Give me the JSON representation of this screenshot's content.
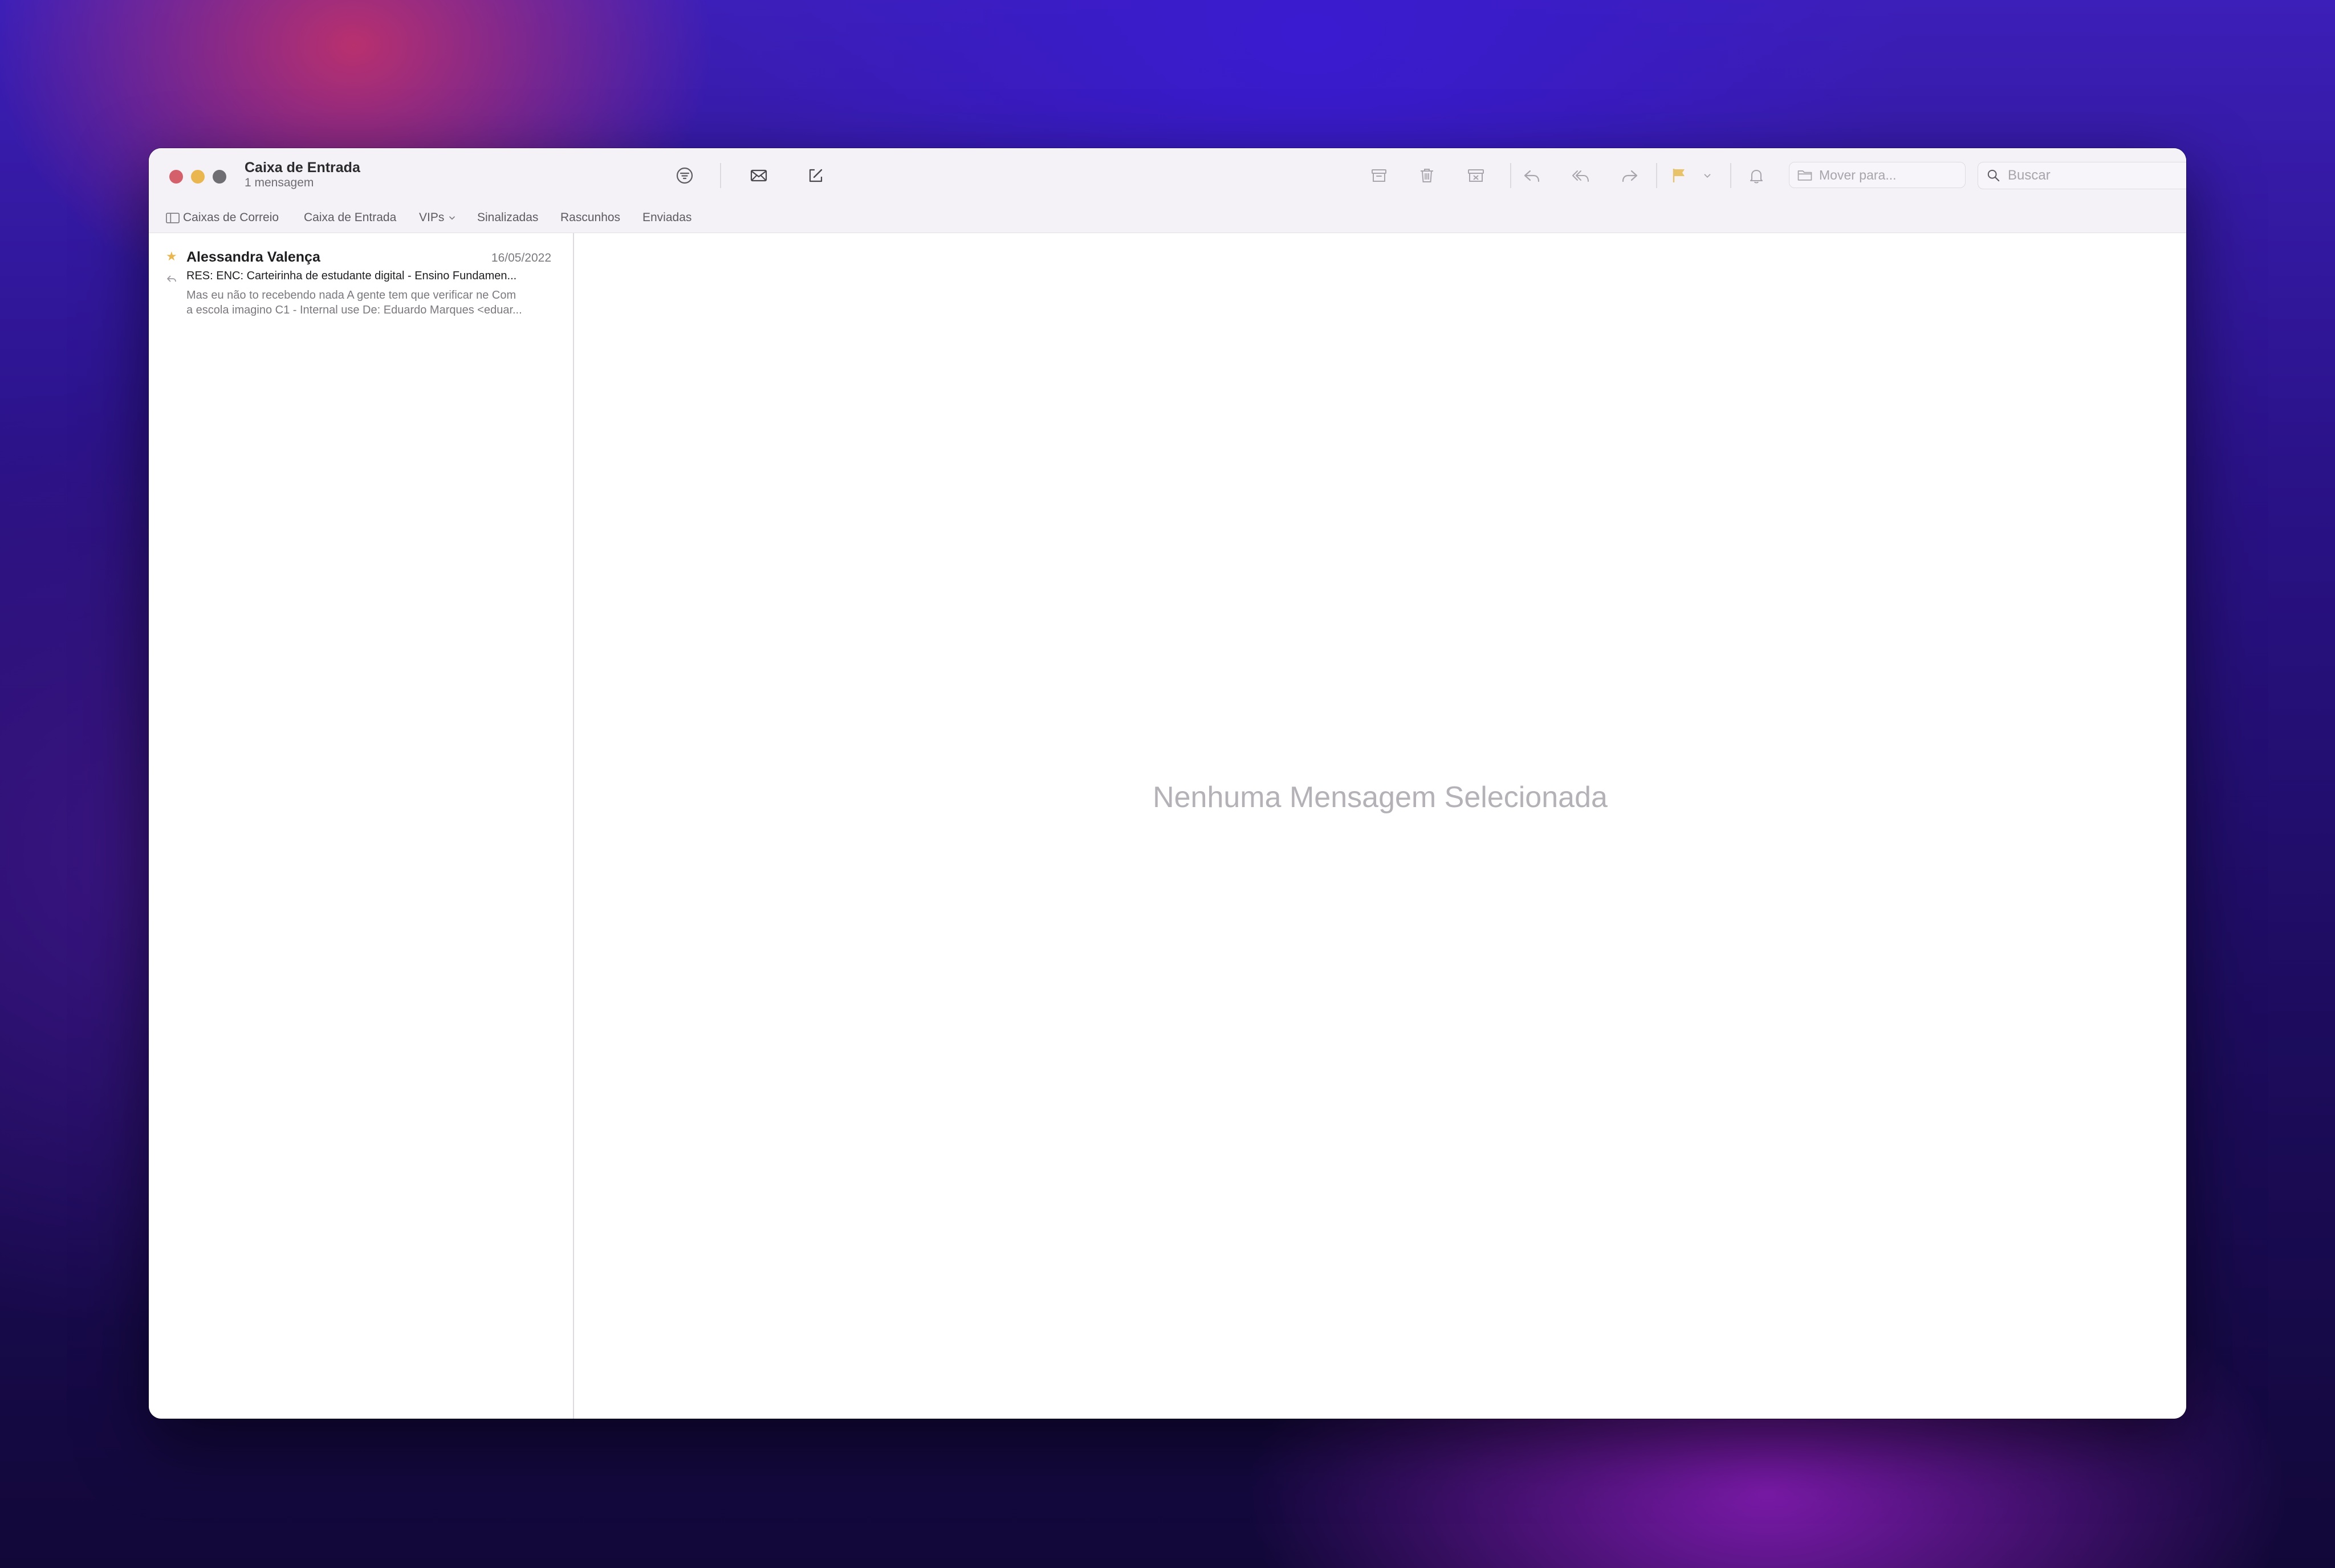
{
  "window": {
    "title": "Caixa de Entrada",
    "subtitle": "1 mensagem"
  },
  "toolbar": {
    "icons": [
      "filter-icon",
      "get-mail-icon",
      "compose-icon",
      "archive-icon",
      "trash-icon",
      "junk-icon",
      "reply-icon",
      "reply-all-icon",
      "forward-icon",
      "flag-icon",
      "flag-menu-chevron-icon",
      "notify-bell-icon"
    ],
    "flag_color": "#e9c36a",
    "move_placeholder": "Mover para...",
    "search_placeholder": "Buscar"
  },
  "favorites": {
    "mailboxes": "Caixas de Correio",
    "inbox": "Caixa de Entrada",
    "vips": "VIPs",
    "flagged": "Sinalizadas",
    "drafts": "Rascunhos",
    "sent": "Enviadas"
  },
  "messages": [
    {
      "sender": "Alessandra Valença",
      "date": "16/05/2022",
      "subject": "RES: ENC: Carteirinha de estudante digital - Ensino Fundamen...",
      "preview_line1": "Mas eu não to recebendo nada A gente tem que verificar ne Com",
      "preview_line2": "a escola imagino C1 - Internal use De: Eduardo Marques <eduar...",
      "starred": true,
      "replied": true
    }
  ],
  "content": {
    "empty_text": "Nenhuma Mensagem Selecionada"
  }
}
